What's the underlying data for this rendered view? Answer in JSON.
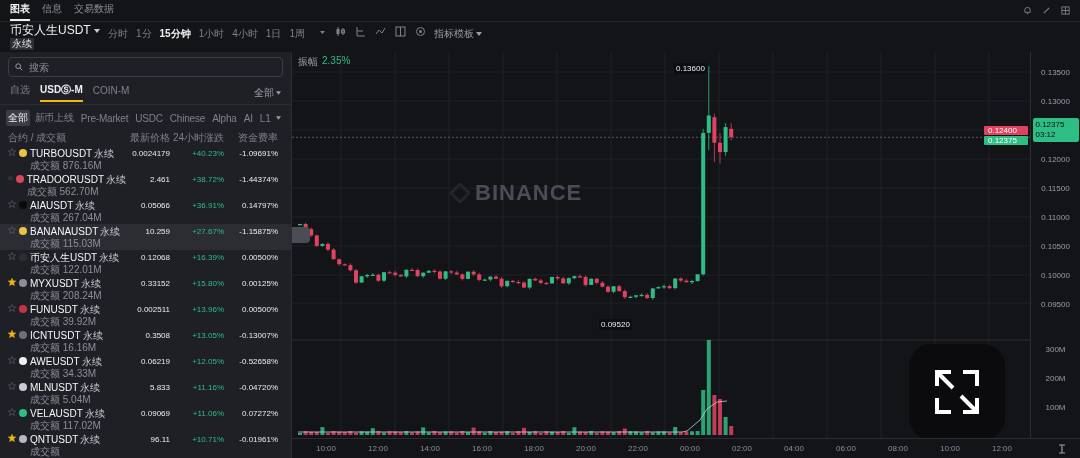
{
  "top_tabs": [
    {
      "label": "图表",
      "selected": true
    },
    {
      "label": "信息",
      "selected": false
    },
    {
      "label": "交易数据",
      "selected": false
    }
  ],
  "symbol": {
    "name": "币安人生USDT",
    "type": "永续"
  },
  "timeframes": [
    {
      "label": "分时",
      "selected": false
    },
    {
      "label": "1分",
      "selected": false
    },
    {
      "label": "15分钟",
      "selected": true
    },
    {
      "label": "1小时",
      "selected": false
    },
    {
      "label": "4小时",
      "selected": false
    },
    {
      "label": "1日",
      "selected": false
    },
    {
      "label": "1周",
      "selected": false
    }
  ],
  "indicator_menu": "指标模板",
  "market_panel": {
    "search": {
      "placeholder": "搜索"
    },
    "market_tabs": [
      {
        "label": "自选",
        "selected": false
      },
      {
        "label": "USDⓈ-M",
        "selected": true
      },
      {
        "label": "COIN-M",
        "selected": false
      }
    ],
    "filter": "全部",
    "chips": [
      {
        "label": "全部",
        "selected": true
      },
      {
        "label": "新币上线",
        "selected": false
      },
      {
        "label": "Pre-Market",
        "selected": false
      },
      {
        "label": "USDC",
        "selected": false
      },
      {
        "label": "Chinese",
        "selected": false
      },
      {
        "label": "Alpha",
        "selected": false
      },
      {
        "label": "AI",
        "selected": false
      },
      {
        "label": "L1",
        "selected": false
      }
    ],
    "columns": [
      "合约 / 成交额",
      "最新价格",
      "24小时涨跌",
      "资金费率"
    ],
    "rows": [
      {
        "symbol": "TURBOUSDT",
        "type": "永续",
        "volume": "成交额 876.16M",
        "price": "0.0024179",
        "change": "+40.23%",
        "funding": "-1.09691%",
        "favorite": false,
        "selected": false,
        "color": "#e8c547"
      },
      {
        "symbol": "TRADOORUSDT",
        "type": "永续",
        "volume": "成交额 562.70M",
        "price": "2.461",
        "change": "+38.72%",
        "funding": "-1.44374%",
        "favorite": false,
        "selected": false,
        "color": "#d9475c"
      },
      {
        "symbol": "AIAUSDT",
        "type": "永续",
        "volume": "成交额 267.04M",
        "price": "0.05066",
        "change": "+36.91%",
        "funding": "0.14797%",
        "favorite": false,
        "selected": false,
        "color": "#0a0a0a"
      },
      {
        "symbol": "BANANAUSDT",
        "type": "永续",
        "volume": "成交额 115.03M",
        "price": "10.259",
        "change": "+27.67%",
        "funding": "-1.15875%",
        "favorite": false,
        "selected": true,
        "color": "#e8c547"
      },
      {
        "symbol": "币安人生USDT",
        "type": "永续",
        "volume": "成交额 122.01M",
        "price": "0.12068",
        "change": "+16.39%",
        "funding": "0.00500%",
        "favorite": false,
        "selected": false,
        "color": "#2b2d33"
      },
      {
        "symbol": "MYXUSDT",
        "type": "永续",
        "volume": "成交额 208.24M",
        "price": "0.33152",
        "change": "+15.80%",
        "funding": "0.00125%",
        "favorite": true,
        "selected": false,
        "color": "#8a8f99"
      },
      {
        "symbol": "FUNUSDT",
        "type": "永续",
        "volume": "成交额 39.92M",
        "price": "0.002511",
        "change": "+13.96%",
        "funding": "0.00500%",
        "favorite": false,
        "selected": false,
        "color": "#c2334a"
      },
      {
        "symbol": "ICNTUSDT",
        "type": "永续",
        "volume": "成交额 16.16M",
        "price": "0.3508",
        "change": "+13.05%",
        "funding": "-0.13007%",
        "favorite": true,
        "selected": false,
        "color": "#6b6f7a"
      },
      {
        "symbol": "AWEUSDT",
        "type": "永续",
        "volume": "成交额 34.33M",
        "price": "0.06219",
        "change": "+12.05%",
        "funding": "-0.52658%",
        "favorite": false,
        "selected": false,
        "color": "#f0f0f0"
      },
      {
        "symbol": "MLNUSDT",
        "type": "永续",
        "volume": "成交额 5.04M",
        "price": "5.833",
        "change": "+11.16%",
        "funding": "-0.04720%",
        "favorite": false,
        "selected": false,
        "color": "#c9ccd2"
      },
      {
        "symbol": "VELAUSDT",
        "type": "永续",
        "volume": "成交额 117.02M",
        "price": "0.09069",
        "change": "+11.06%",
        "funding": "0.07272%",
        "favorite": false,
        "selected": false,
        "color": "#2ebd85"
      },
      {
        "symbol": "QNTUSDT",
        "type": "永续",
        "volume": "成交额",
        "price": "96.11",
        "change": "+10.71%",
        "funding": "-0.01961%",
        "favorite": true,
        "selected": false,
        "color": "#b5b8bf"
      }
    ]
  },
  "chart": {
    "legend_label": "振幅",
    "legend_value": "2.35%",
    "watermark": "BINANCE",
    "high_marker": "0.13600",
    "low_marker": "0.09520",
    "order_tags": [
      {
        "kind": "sell",
        "label": "0.12400"
      },
      {
        "kind": "buy",
        "label": "0.12375"
      }
    ],
    "price_axis": [
      {
        "kind": "tick",
        "label": "0.13500"
      },
      {
        "kind": "tick",
        "label": "0.13000"
      },
      {
        "kind": "last",
        "label": "0.12375",
        "sub": "03:12"
      },
      {
        "kind": "tick",
        "label": "0.12000"
      },
      {
        "kind": "tick",
        "label": "0.11500"
      },
      {
        "kind": "tick",
        "label": "0.11000"
      },
      {
        "kind": "tick",
        "label": "0.10500"
      },
      {
        "kind": "tick",
        "label": "0.10000"
      },
      {
        "kind": "tick",
        "label": "0.09500"
      }
    ],
    "volume_axis": [
      "300M",
      "200M",
      "100M"
    ],
    "time_axis": [
      "10:00",
      "12:00",
      "14:00",
      "16:00",
      "18:00",
      "20:00",
      "22:00",
      "00:00",
      "02:00",
      "04:00",
      "06:00",
      "08:00",
      "10:00",
      "12:00"
    ]
  }
}
